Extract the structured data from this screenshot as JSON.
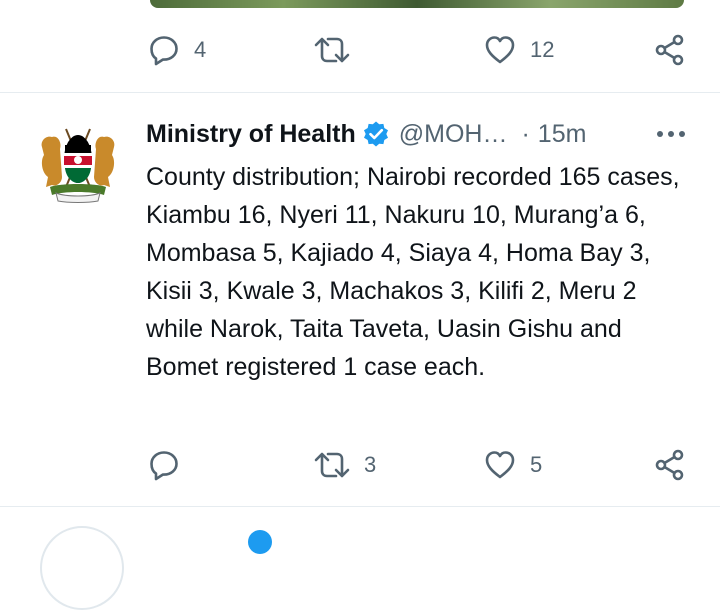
{
  "previous_tweet": {
    "reply_count": "4",
    "retweet_count": "",
    "like_count": "12"
  },
  "tweet": {
    "author_name": "Ministry of Health",
    "handle": "@MOH…",
    "separator": "·",
    "time": "15m",
    "text": "County distribution; Nairobi recorded 165 cases, Kiambu 16, Nyeri 11, Nakuru 10, Murang’a 6, Mombasa 5, Kajiado 4, Siaya 4, Homa Bay 3, Kisii 3, Kwale 3, Machakos 3, Kilifi 2, Meru 2 while Narok, Taita Taveta, Uasin Gishu and Bomet registered 1 case each.",
    "reply_count": "",
    "retweet_count": "3",
    "like_count": "5"
  },
  "icons": {
    "reply": "reply-icon",
    "retweet": "retweet-icon",
    "like": "heart-icon",
    "share": "share-icon",
    "verified": "verified-badge-icon",
    "more": "more-options-icon"
  },
  "colors": {
    "text": "#0f1419",
    "secondary": "#536471",
    "verified": "#1d9bf0",
    "divider": "#e6ecf0"
  }
}
